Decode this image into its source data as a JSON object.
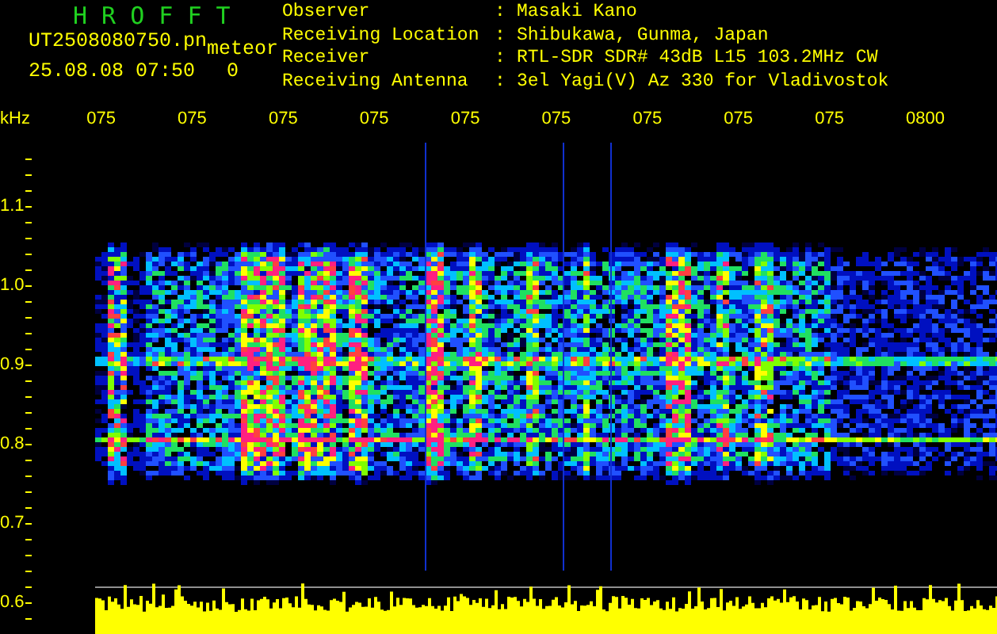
{
  "app": {
    "title": "H R O F F T"
  },
  "file": {
    "name": "UT2508080750.pn",
    "mode": "meteor",
    "datetime": "25.08.08 07:50",
    "count": "0"
  },
  "info": [
    {
      "label": "Observer",
      "separator": ":",
      "value": "Masaki Kano"
    },
    {
      "label": "Receiving Location",
      "separator": ":",
      "value": "Shibukawa, Gunma, Japan"
    },
    {
      "label": "Receiver",
      "separator": ":",
      "value": "RTL-SDR SDR# 43dB L15 103.2MHz CW"
    },
    {
      "label": "Receiving Antenna",
      "separator": ":",
      "value": "3el Yagi(V) Az 330 for Vladivostok"
    }
  ],
  "axis": {
    "unit": "kHz",
    "time_labels": [
      "075",
      "075",
      "075",
      "075",
      "075",
      "075",
      "075",
      "075",
      "075",
      "0800"
    ],
    "freq_labels": [
      "1.1",
      "1.0",
      "0.9",
      "0.8",
      "0.7",
      "0.6"
    ]
  }
}
